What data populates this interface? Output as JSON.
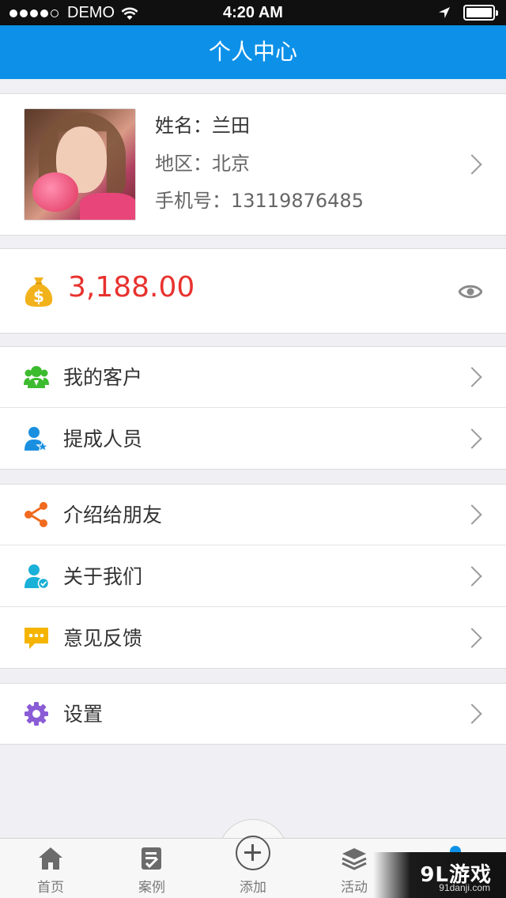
{
  "status_bar": {
    "carrier": "DEMO",
    "time": "4:20 AM",
    "icons": [
      "signal-dots-icon",
      "wifi-icon",
      "location-arrow-icon",
      "battery-icon"
    ]
  },
  "nav": {
    "title": "个人中心"
  },
  "profile": {
    "name": "姓名：兰田",
    "region": "地区：北京",
    "phone": "手机号：13119876485"
  },
  "balance": {
    "amount": "3,188.00",
    "icon": "money-bag-icon",
    "toggle_icon": "eye-icon"
  },
  "menu_groups": [
    [
      {
        "label": "我的客户",
        "icon": "customers-icon",
        "color": "#3dbb2f"
      },
      {
        "label": "提成人员",
        "icon": "person-star-icon",
        "color": "#1a8fe0"
      }
    ],
    [
      {
        "label": "介绍给朋友",
        "icon": "share-icon",
        "color": "#f06a1f"
      },
      {
        "label": "关于我们",
        "icon": "person-check-icon",
        "color": "#1ab0d8"
      },
      {
        "label": "意见反馈",
        "icon": "chat-bubble-icon",
        "color": "#f4b400"
      }
    ],
    [
      {
        "label": "设置",
        "icon": "gear-icon",
        "color": "#8a5cd6"
      }
    ]
  ],
  "tab_bar": {
    "tabs": [
      {
        "label": "首页",
        "icon": "home-icon"
      },
      {
        "label": "案例",
        "icon": "case-list-icon"
      },
      {
        "label": "添加",
        "icon": "add-circle-icon"
      },
      {
        "label": "活动",
        "icon": "layers-icon"
      }
    ]
  },
  "watermark": {
    "main": "9L游戏",
    "sub": "91danji.com"
  },
  "colors": {
    "nav": "#0d91e8",
    "amount": "#e8322e",
    "background": "#efeff4"
  }
}
